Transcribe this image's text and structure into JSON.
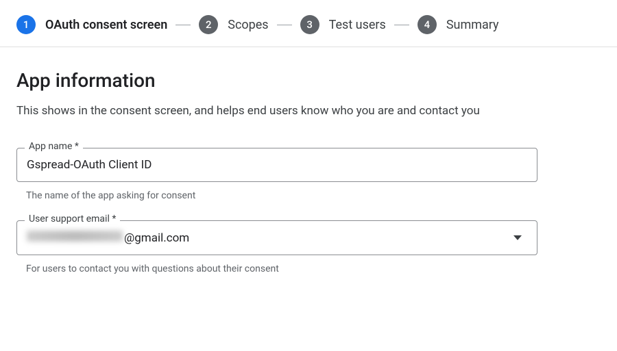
{
  "stepper": {
    "steps": [
      {
        "num": "1",
        "label": "OAuth consent screen",
        "active": true
      },
      {
        "num": "2",
        "label": "Scopes",
        "active": false
      },
      {
        "num": "3",
        "label": "Test users",
        "active": false
      },
      {
        "num": "4",
        "label": "Summary",
        "active": false
      }
    ]
  },
  "section": {
    "title": "App information",
    "description": "This shows in the consent screen, and helps end users know who you are and contact you"
  },
  "fields": {
    "app_name": {
      "label": "App name *",
      "value": "Gspread-OAuth Client ID",
      "helper": "The name of the app asking for consent"
    },
    "user_support_email": {
      "label": "User support email *",
      "value_suffix": "@gmail.com",
      "helper": "For users to contact you with questions about their consent"
    }
  }
}
